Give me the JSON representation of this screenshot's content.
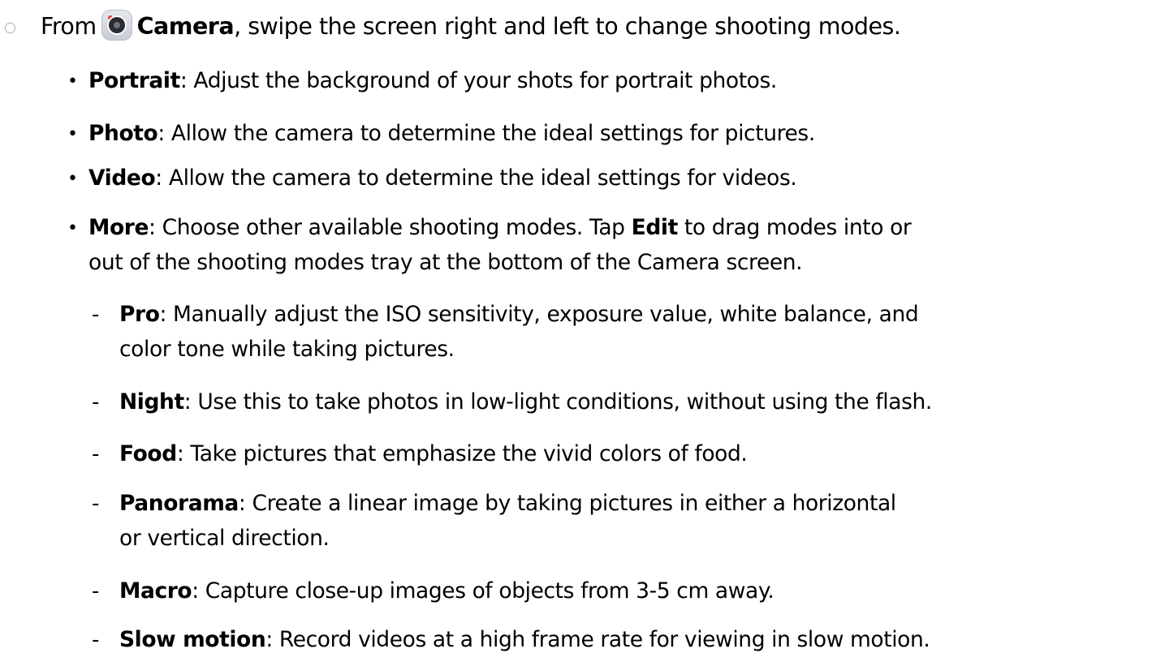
{
  "intro": {
    "prefix": "From",
    "app_name": "Camera",
    "suffix": ", swipe the screen right and left to change shooting modes."
  },
  "modes": [
    {
      "term": "Portrait",
      "sep": ":",
      "text": " Adjust the background of your shots for portrait photos."
    },
    {
      "term": "Photo",
      "sep": ":",
      "text": " Allow the camera to determine the ideal settings for pictures."
    },
    {
      "term": "Video",
      "sep": ":",
      "text": " Allow the camera to determine the ideal settings for videos."
    },
    {
      "term": "More",
      "sep": ":",
      "text_a": " Choose other available shooting modes. Tap ",
      "edit": "Edit",
      "text_b": " to drag modes into or",
      "text_line2": "out of the shooting modes tray at the bottom of the Camera screen."
    }
  ],
  "more_modes": [
    {
      "term": "Pro",
      "sep": ":",
      "text": " Manually adjust the ISO sensitivity, exposure value, white balance, and",
      "text_line2": "color tone while taking pictures."
    },
    {
      "term": "Night",
      "sep": ":",
      "text": " Use this to take photos in low-light conditions, without using the flash."
    },
    {
      "term": "Food",
      "sep": ":",
      "text": " Take pictures that emphasize the vivid colors of food."
    },
    {
      "term": "Panorama",
      "sep": ":",
      "text": " Create a linear image by taking pictures in either a horizontal",
      "text_line2": "or vertical direction."
    },
    {
      "term": "Macro",
      "sep": ":",
      "text": " Capture close-up images of objects from 3-5 cm away."
    },
    {
      "term": "Slow motion",
      "sep": ":",
      "text": " Record videos at a high frame rate for viewing in slow motion."
    }
  ],
  "bullet_glyph": "•",
  "dash_glyph": "-",
  "colors": {
    "text": "#000000",
    "camera_icon_bg": "#d7dae1",
    "camera_icon_dot": "#e8412c"
  },
  "icons": {
    "step_marker": "step-marker-icon",
    "camera": "camera-app-icon"
  }
}
